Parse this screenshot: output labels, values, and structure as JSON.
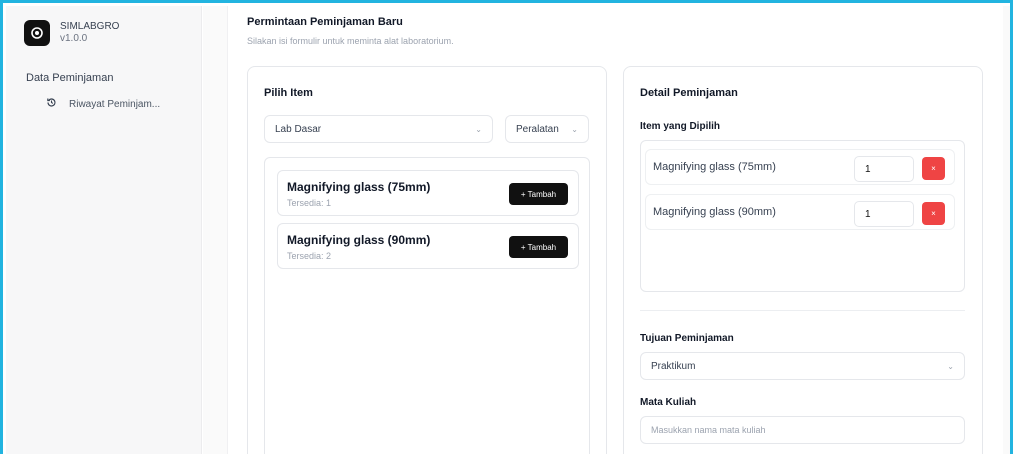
{
  "app": {
    "name": "SIMLABGRO",
    "version": "v1.0.0",
    "accent": "#111111",
    "danger": "#ef4444"
  },
  "sidebar": {
    "group_label": "Data Peminjaman",
    "items": [
      {
        "label": "Riwayat Peminjam...",
        "icon": "history-icon"
      }
    ]
  },
  "page": {
    "title": "Permintaan Peminjaman Baru",
    "subtitle": "Silakan isi formulir untuk meminta alat laboratorium."
  },
  "pick": {
    "title": "Pilih Item",
    "lab_select": "Lab Dasar",
    "type_select": "Peralatan",
    "items": [
      {
        "name": "Magnifying glass (75mm)",
        "stock": "Tersedia: 1",
        "add_label": "+ Tambah"
      },
      {
        "name": "Magnifying glass (90mm)",
        "stock": "Tersedia: 2",
        "add_label": "+ Tambah"
      }
    ]
  },
  "detail": {
    "title": "Detail Peminjaman",
    "selected_label": "Item yang Dipilih",
    "selected": [
      {
        "name": "Magnifying glass (75mm)",
        "qty": "1",
        "remove": "×"
      },
      {
        "name": "Magnifying glass (90mm)",
        "qty": "1",
        "remove": "×"
      }
    ],
    "purpose_label": "Tujuan Peminjaman",
    "purpose_value": "Praktikum",
    "course_label": "Mata Kuliah",
    "course_placeholder": "Masukkan nama mata kuliah"
  }
}
